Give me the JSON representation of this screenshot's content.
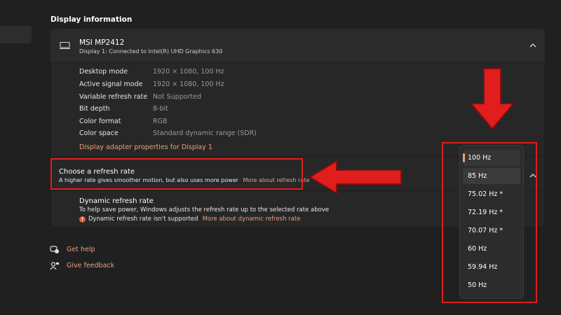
{
  "section": {
    "title": "Display information"
  },
  "monitor": {
    "name": "MSI MP2412",
    "subtitle": "Display 1: Connected to Intel(R) UHD Graphics 630"
  },
  "info": [
    {
      "label": "Desktop mode",
      "value": "1920 × 1080, 100 Hz"
    },
    {
      "label": "Active signal mode",
      "value": "1920 × 1080, 100 Hz"
    },
    {
      "label": "Variable refresh rate",
      "value": "Not Supported"
    },
    {
      "label": "Bit depth",
      "value": "8-bit"
    },
    {
      "label": "Color format",
      "value": "RGB"
    },
    {
      "label": "Color space",
      "value": "Standard dynamic range (SDR)"
    }
  ],
  "adapter_link": "Display adapter properties for Display 1",
  "refresh": {
    "title": "Choose a refresh rate",
    "description": "A higher rate gives smoother motion, but also uses more power",
    "link": "More about refresh rate"
  },
  "dynamic": {
    "title": "Dynamic refresh rate",
    "description": "To help save power, Windows adjusts the refresh rate up to the selected rate above",
    "warning": "Dynamic refresh rate isn't supported",
    "link": "More about dynamic refresh rate"
  },
  "footer": {
    "help": "Get help",
    "feedback": "Give feedback"
  },
  "dropdown": {
    "options": [
      "100 Hz",
      "85 Hz",
      "75.02 Hz *",
      "72.19 Hz *",
      "70.07 Hz *",
      "60 Hz",
      "59.94 Hz",
      "50 Hz"
    ],
    "selected": "100 Hz"
  },
  "colors": {
    "accent": "#e8a37a",
    "annotation": "#e01e1e",
    "background": "#202020",
    "card": "#272727"
  },
  "icons": [
    "monitor-icon",
    "chevron-up-icon",
    "warning-icon",
    "help-icon",
    "feedback-icon",
    "arrow-down-annotation",
    "arrow-left-annotation"
  ]
}
